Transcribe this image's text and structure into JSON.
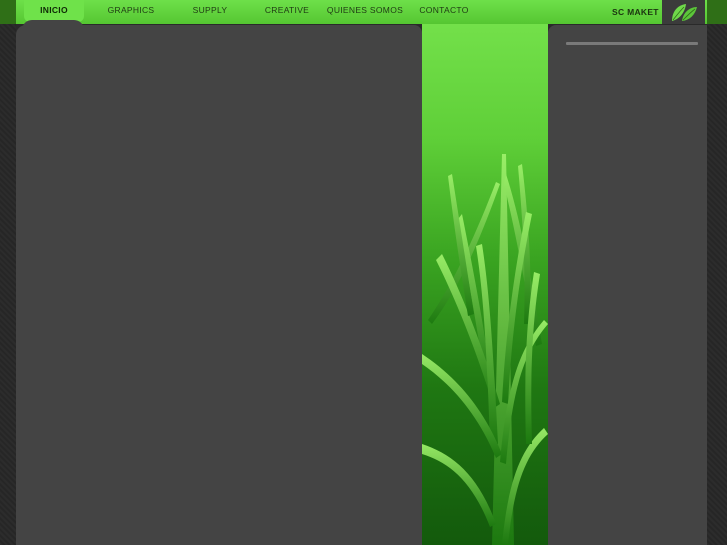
{
  "nav": {
    "items": [
      {
        "label": "INICIO",
        "active": true
      },
      {
        "label": "GRAPHICS",
        "active": false
      },
      {
        "label": "SUPPLY",
        "active": false
      },
      {
        "label": "CREATIVE",
        "active": false
      },
      {
        "label": "QUIENES SOMOS",
        "active": false
      },
      {
        "label": "CONTACTO",
        "active": false
      }
    ]
  },
  "brand": {
    "name": "SC MAKET",
    "logo_icon": "leaf-logo-icon"
  },
  "colors": {
    "accent_green": "#6ee04a",
    "panel_gray": "#444444",
    "page_bg": "#2a2a2a"
  },
  "hero": {
    "image_icon": "grass-photo"
  }
}
